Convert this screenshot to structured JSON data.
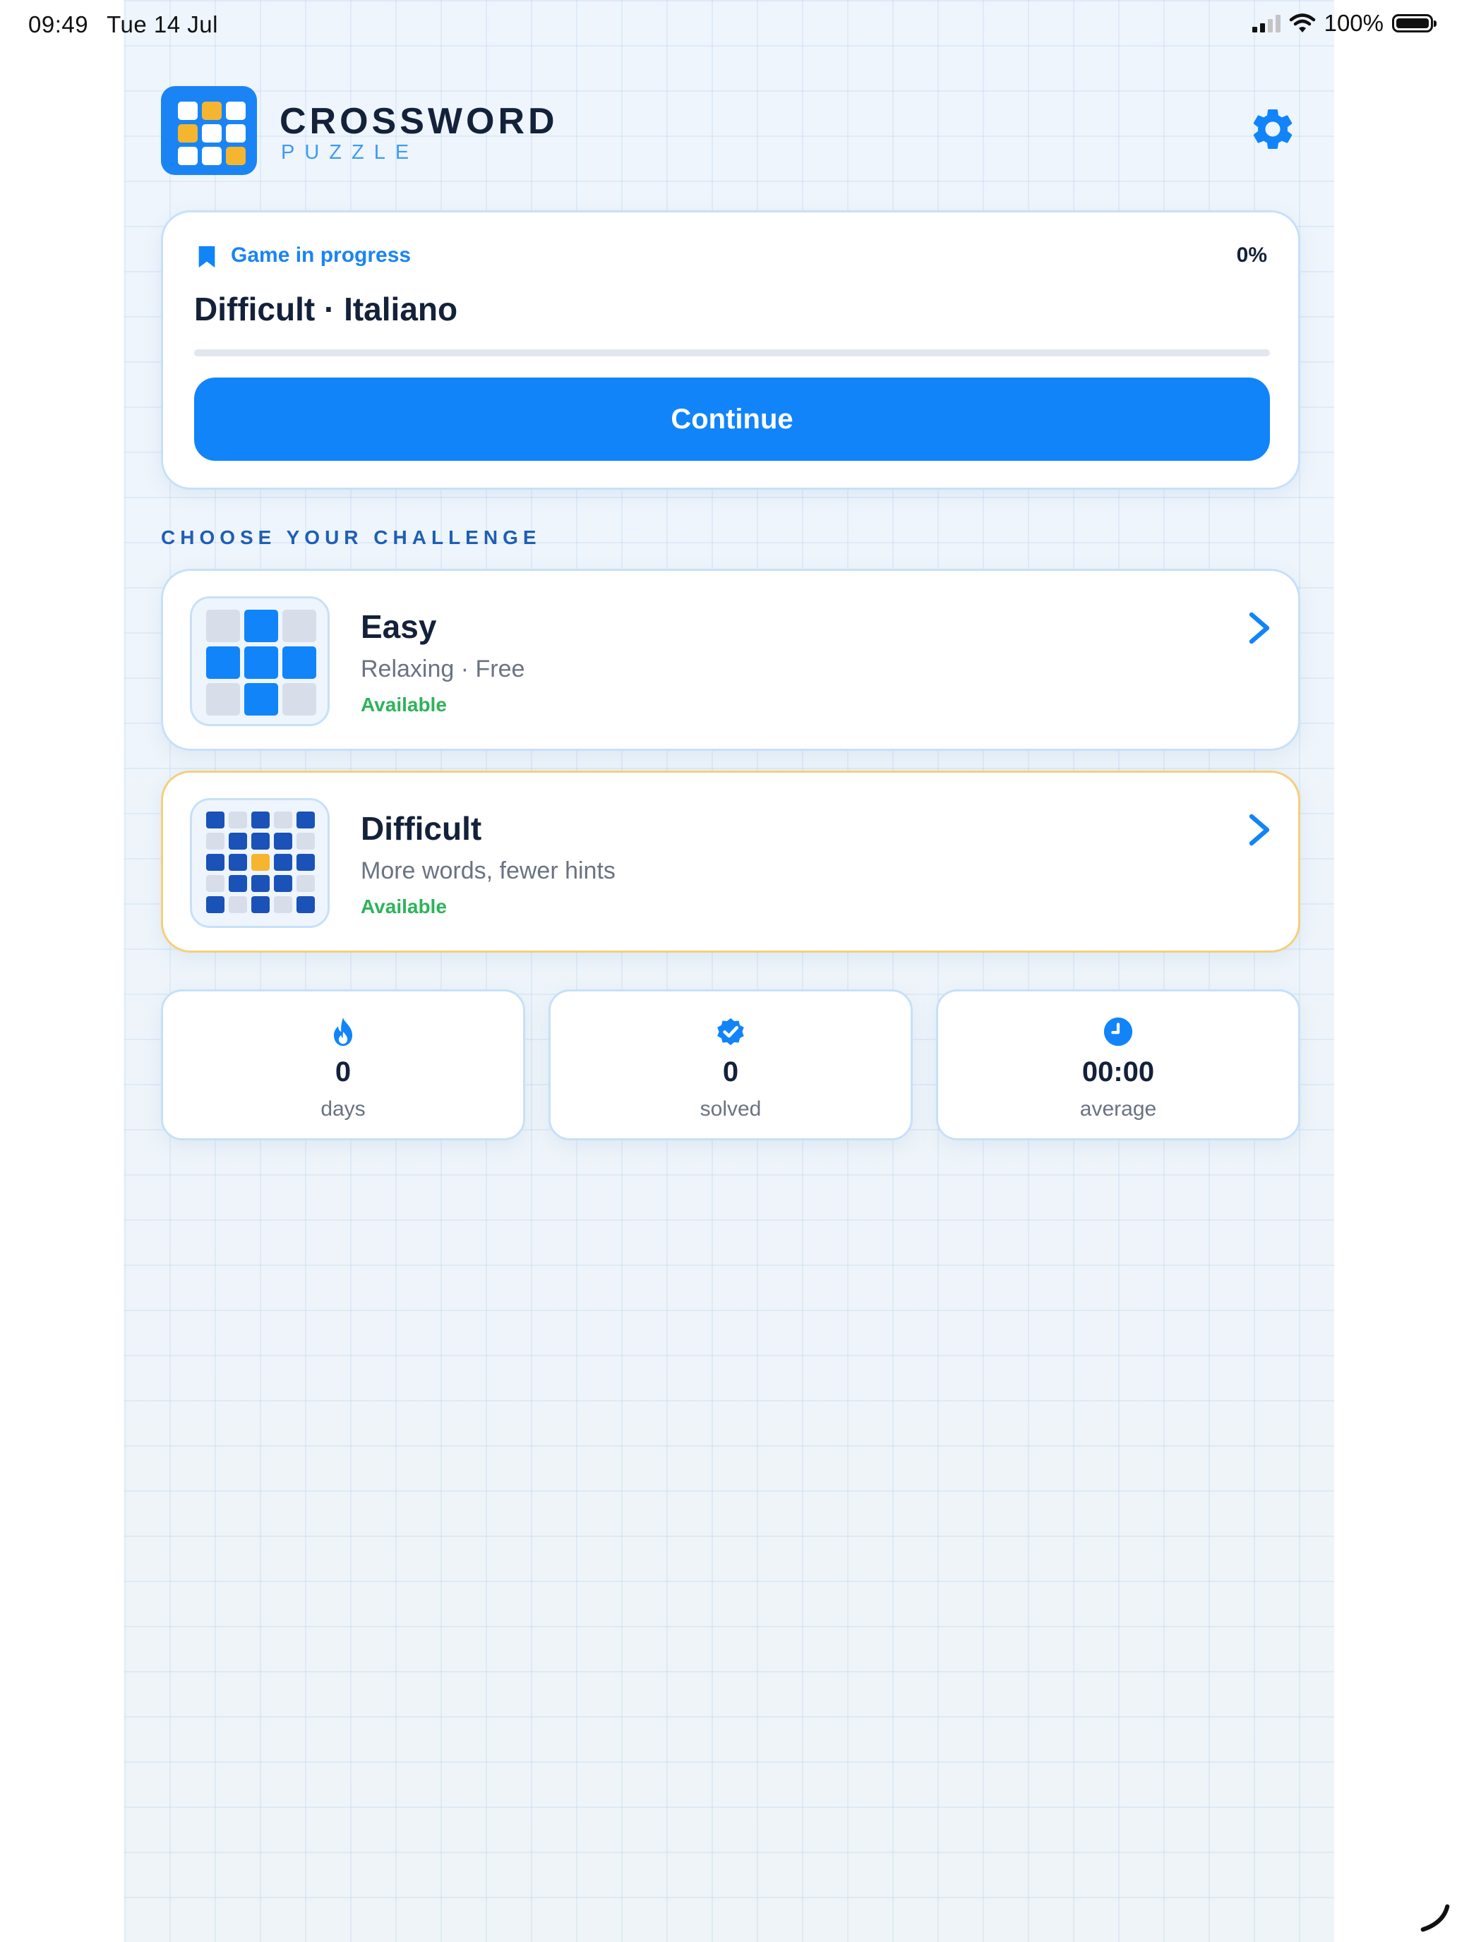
{
  "status_bar": {
    "time": "09:49",
    "date": "Tue 14 Jul",
    "battery": "100%"
  },
  "header": {
    "title": "CROSSWORD",
    "subtitle": "PUZZLE"
  },
  "progress_card": {
    "label": "Game in progress",
    "percent_label": "0%",
    "progress_fraction": 0,
    "game_title": "Difficult · Italiano",
    "continue_label": "Continue"
  },
  "section": {
    "title": "CHOOSE YOUR CHALLENGE"
  },
  "levels": [
    {
      "name": "Easy",
      "description": "Relaxing · Free",
      "status": "Available"
    },
    {
      "name": "Difficult",
      "description": "More words, fewer hints",
      "status": "Available"
    }
  ],
  "stats": [
    {
      "value": "0",
      "label": "days",
      "icon": "flame-icon"
    },
    {
      "value": "0",
      "label": "solved",
      "icon": "verified-badge-icon"
    },
    {
      "value": "00:00",
      "label": "average",
      "icon": "clock-icon"
    }
  ],
  "colors": {
    "accent": "#1184fa",
    "brand_yellow": "#f5b52e",
    "available_green": "#2db35a",
    "dark_navy": "#14213a"
  }
}
